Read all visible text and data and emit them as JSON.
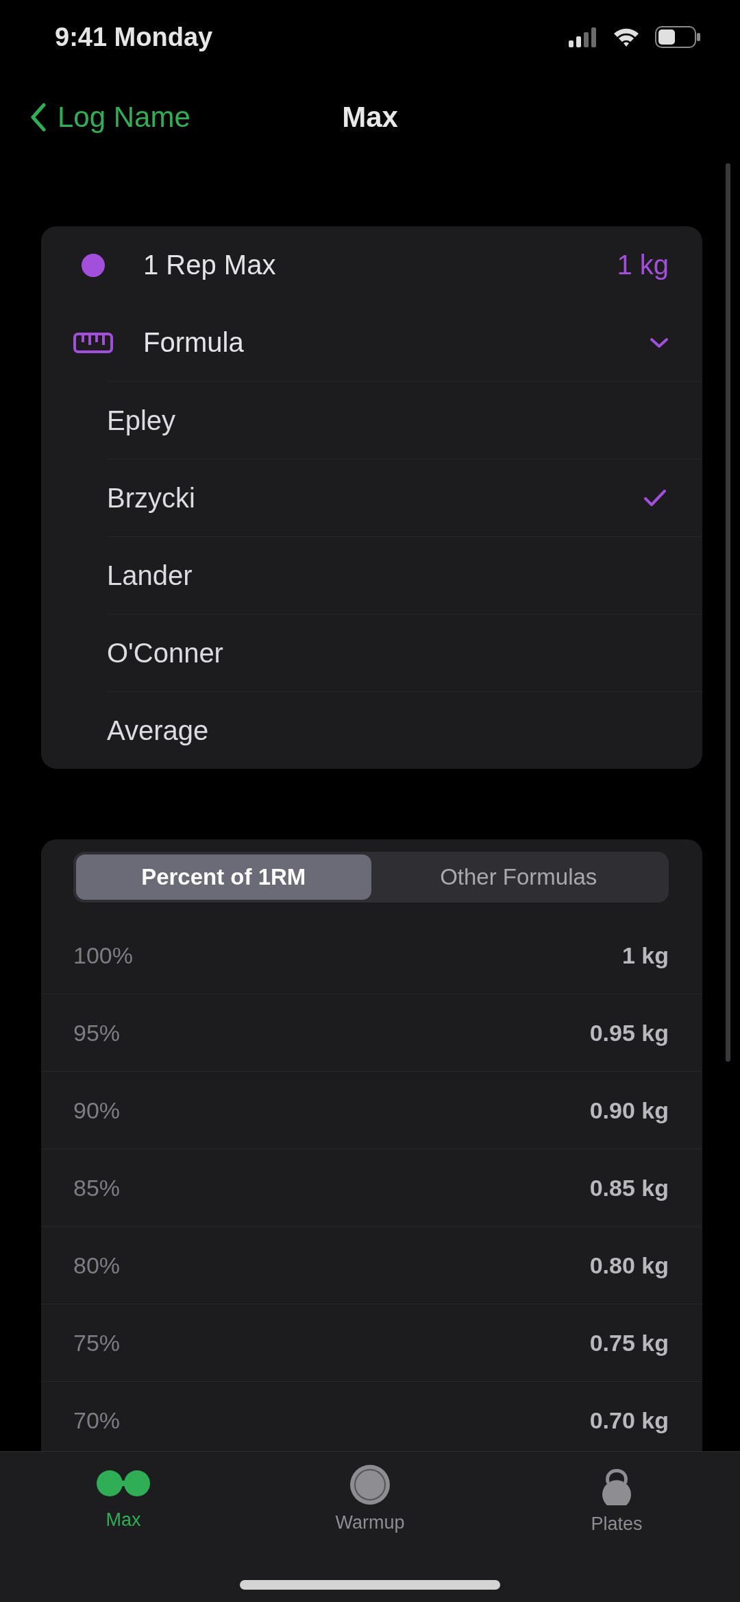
{
  "status_bar": {
    "time": "9:41 Monday"
  },
  "nav": {
    "back_label": "Log Name",
    "title": "Max"
  },
  "one_rep_max": {
    "label": "1 Rep Max",
    "value": "1 kg"
  },
  "formula": {
    "label": "Formula",
    "expanded": true,
    "options": [
      {
        "label": "Epley",
        "selected": false
      },
      {
        "label": "Brzycki",
        "selected": true
      },
      {
        "label": "Lander",
        "selected": false
      },
      {
        "label": "O'Conner",
        "selected": false
      },
      {
        "label": "Average",
        "selected": false
      }
    ]
  },
  "segments": [
    {
      "label": "Percent of 1RM",
      "selected": true
    },
    {
      "label": "Other Formulas",
      "selected": false
    }
  ],
  "percent_table": {
    "rows": [
      {
        "percent": "100%",
        "weight": "1 kg"
      },
      {
        "percent": "95%",
        "weight": "0.95 kg"
      },
      {
        "percent": "90%",
        "weight": "0.90 kg"
      },
      {
        "percent": "85%",
        "weight": "0.85 kg"
      },
      {
        "percent": "80%",
        "weight": "0.80 kg"
      },
      {
        "percent": "75%",
        "weight": "0.75 kg"
      },
      {
        "percent": "70%",
        "weight": "0.70 kg"
      }
    ]
  },
  "tab_bar": {
    "tabs": [
      {
        "label": "Max",
        "selected": true
      },
      {
        "label": "Warmup",
        "selected": false
      },
      {
        "label": "Plates",
        "selected": false
      }
    ]
  }
}
